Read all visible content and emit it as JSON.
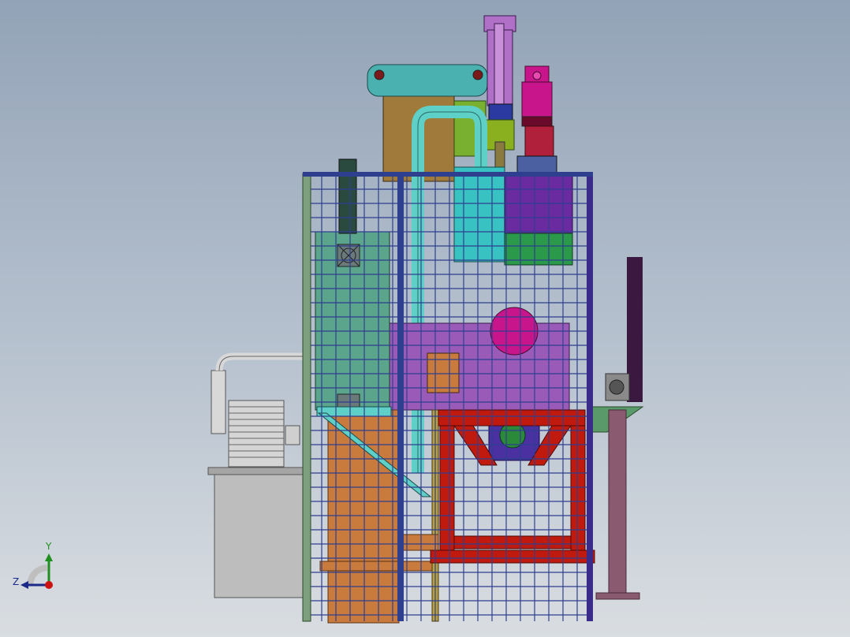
{
  "viewport": {
    "background_top": "#93a3b7",
    "background_bottom": "#d9dde1"
  },
  "triad": {
    "y_label": "Y",
    "z_label": "Z",
    "y_color": "#1f8f1f",
    "z_color": "#1b2a88",
    "x_color": "#cc1111"
  },
  "colors": {
    "frame_blue": "#2f3f8f",
    "panel_green": "#5aa58c",
    "pipe_cyan": "#5fd0c8",
    "teal_beam": "#4bb0b0",
    "red_frame": "#c01a0e",
    "motor_magenta": "#c8158c",
    "cylinder_violet": "#b070c8",
    "tank_gray": "#bdbdbd",
    "wood_orange": "#c97b3d",
    "dark_post": "#3a1840"
  }
}
